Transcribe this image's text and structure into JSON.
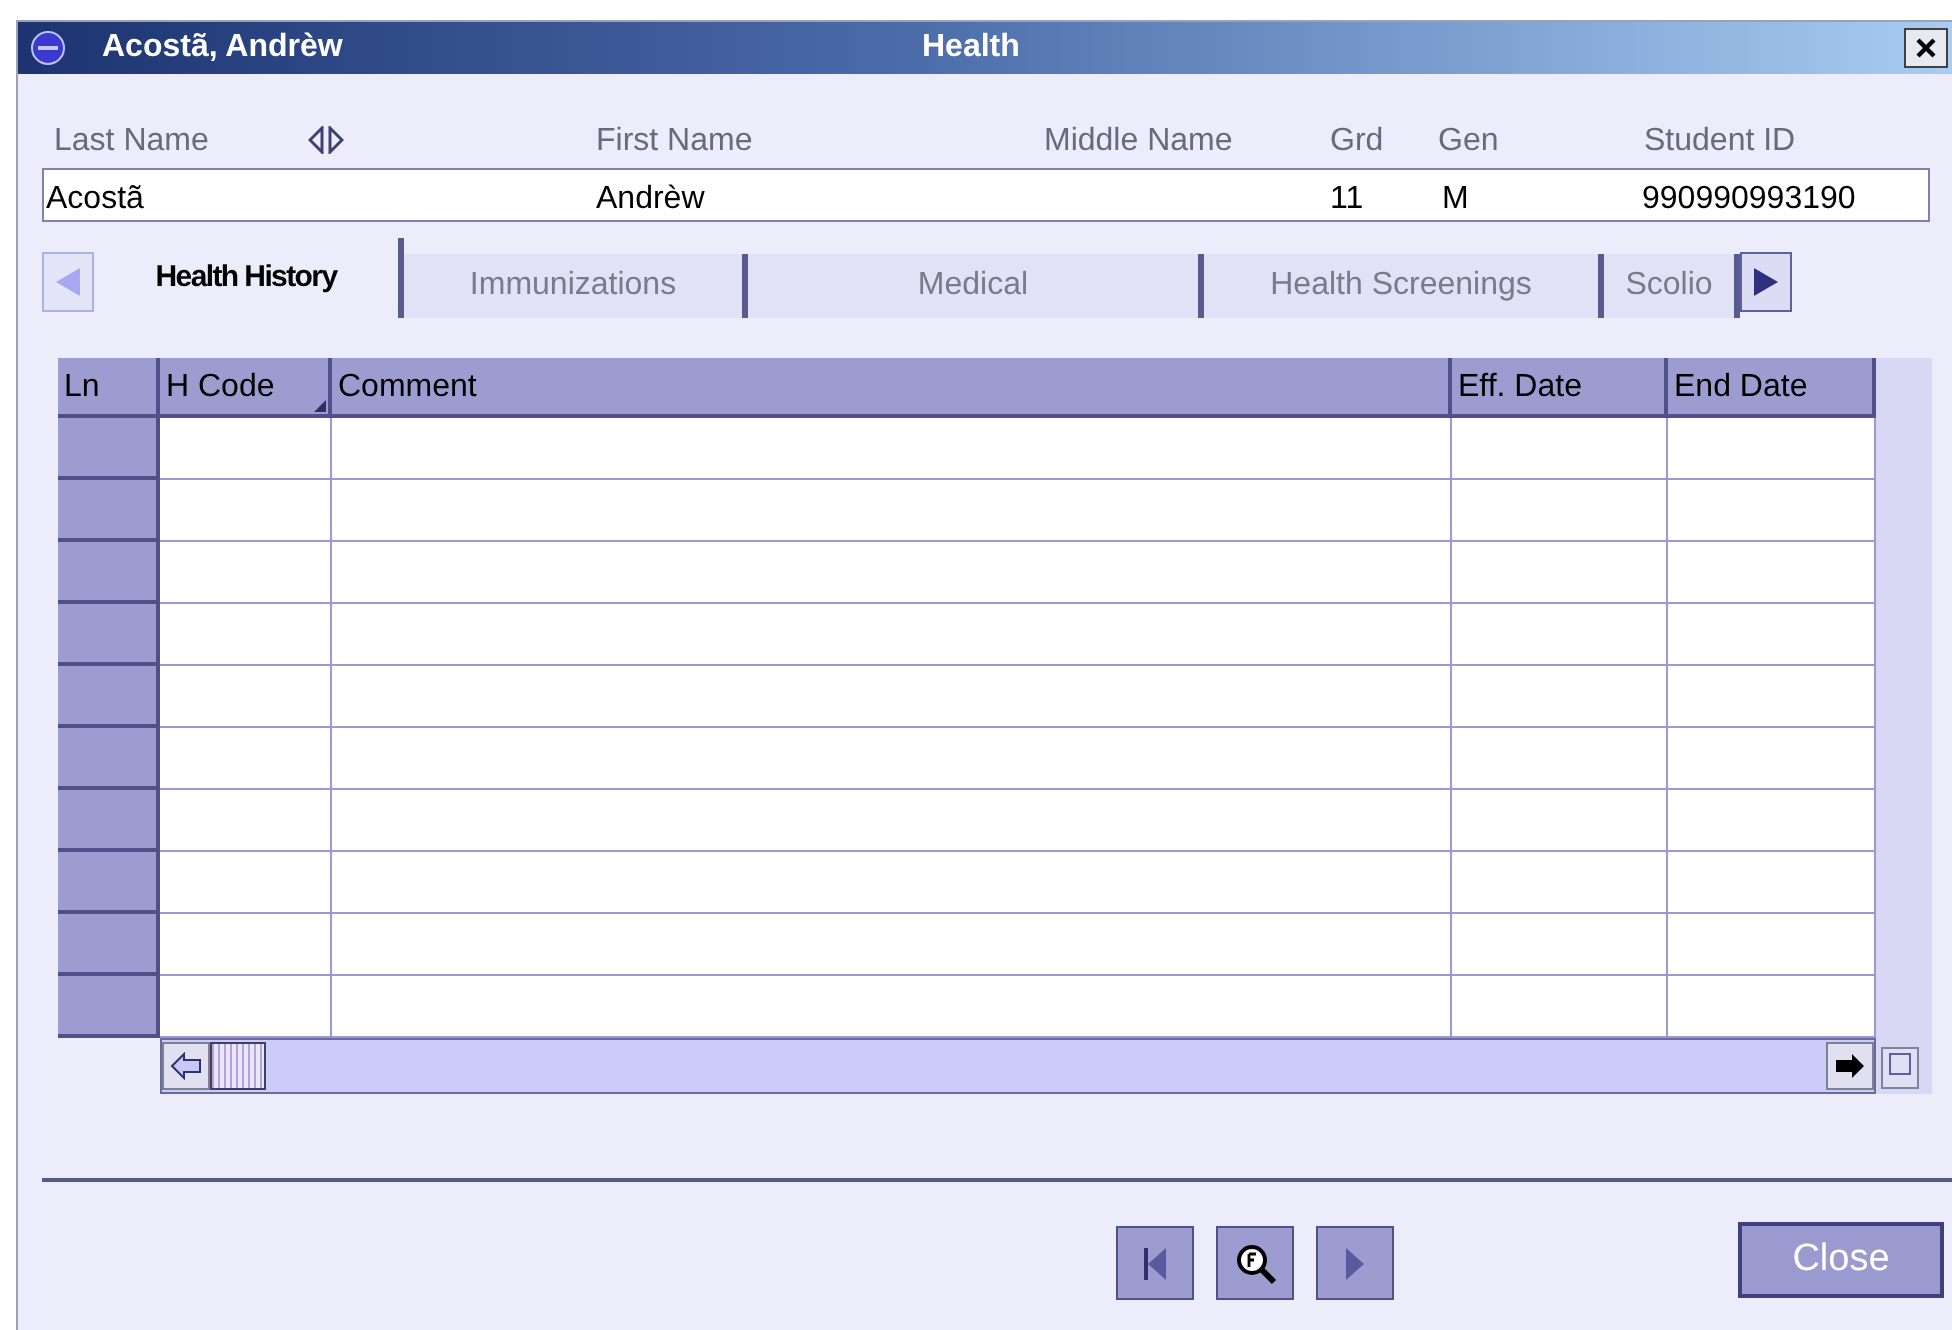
{
  "window": {
    "name": "Acostã, Andrèw",
    "title": "Health"
  },
  "header_fields": [
    {
      "label": "Last Name",
      "value": "Acostã",
      "sortable": true
    },
    {
      "label": "First Name",
      "value": "Andrèw"
    },
    {
      "label": "Middle Name"
    },
    {
      "label": "Grd",
      "value": "11"
    },
    {
      "label": "Gen",
      "value": "M"
    },
    {
      "label": "Student ID",
      "value": "990990993190"
    }
  ],
  "tab_arrows": [
    {
      "kind": "back",
      "disabled": true
    },
    {
      "kind": "forward",
      "disabled": false
    }
  ],
  "tabs": [
    {
      "label": "Health History",
      "selected": true
    },
    {
      "label": "Immunizations",
      "selected": false
    },
    {
      "label": "Medical",
      "selected": false
    },
    {
      "label": "Health Screenings",
      "selected": false
    },
    {
      "label": "Scolio",
      "selected": false
    }
  ],
  "table": {
    "columns": [
      {
        "label": "Ln"
      },
      {
        "label": "H Code",
        "sorted": true
      },
      {
        "label": "Comment"
      },
      {
        "label": "Eff. Date"
      },
      {
        "label": "End Date"
      }
    ]
  },
  "nav_buttons": [
    {
      "kind": "previous"
    },
    {
      "kind": "find"
    },
    {
      "kind": "next"
    }
  ],
  "close_button": "Close"
}
